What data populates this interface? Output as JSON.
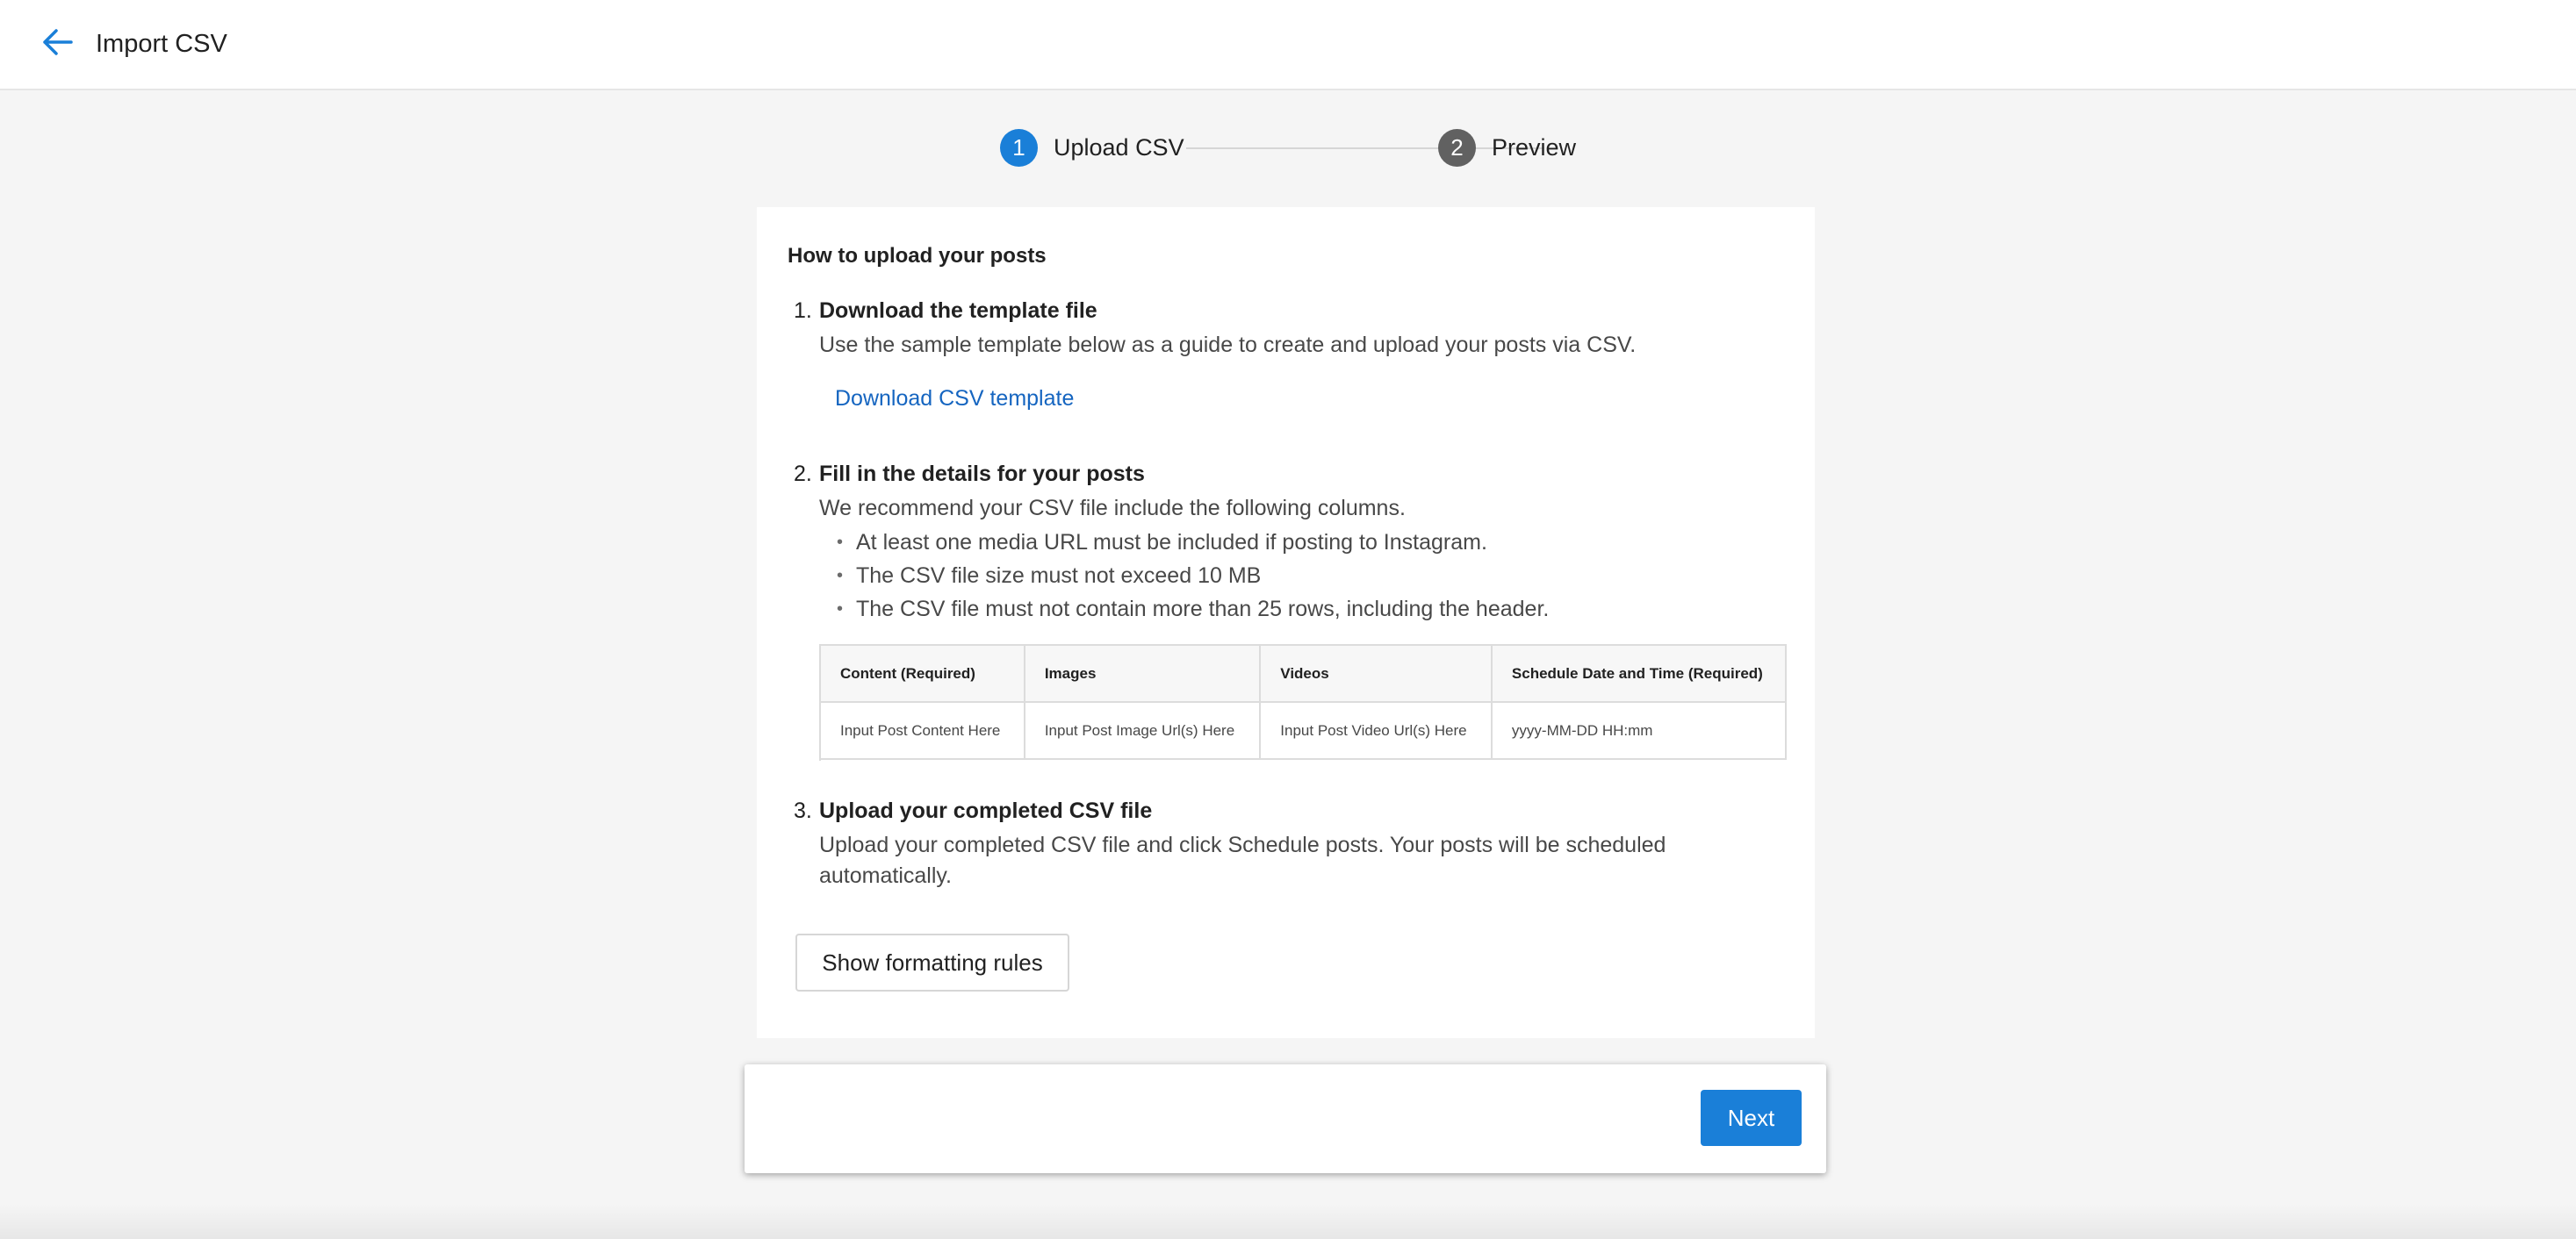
{
  "header": {
    "title": "Import CSV",
    "back_icon": "arrow-left-icon",
    "accent_color": "#1a7fd8"
  },
  "stepper": {
    "steps": [
      {
        "number": "1",
        "label": "Upload CSV",
        "state": "active",
        "color": "#1a7fd8"
      },
      {
        "number": "2",
        "label": "Preview",
        "state": "inactive",
        "color": "#616161"
      }
    ]
  },
  "instructions": {
    "heading": "How to upload your posts",
    "step1": {
      "number": "1.",
      "title": "Download the template file",
      "description": "Use the sample template below as a guide to create and upload your posts via CSV.",
      "link": "Download CSV template"
    },
    "step2": {
      "number": "2.",
      "title": "Fill in the details for your posts",
      "description": "We recommend your CSV file include the following columns.",
      "bullets": [
        "At least one media URL must be included if posting to Instagram.",
        "The CSV file size must not exceed 10 MB",
        "The CSV file must not contain more than 25 rows, including the header."
      ],
      "table": {
        "headers": [
          "Content (Required)",
          "Images",
          "Videos",
          "Schedule Date and Time (Required)"
        ],
        "row": [
          "Input Post Content Here",
          "Input Post Image Url(s) Here",
          "Input Post Video Url(s) Here",
          "yyyy-MM-DD HH:mm"
        ]
      }
    },
    "step3": {
      "number": "3.",
      "title": "Upload your completed CSV file",
      "description": "Upload your completed CSV file and click Schedule posts. Your posts will be scheduled automatically."
    },
    "format_button": "Show formatting rules"
  },
  "footer": {
    "next_label": "Next"
  }
}
